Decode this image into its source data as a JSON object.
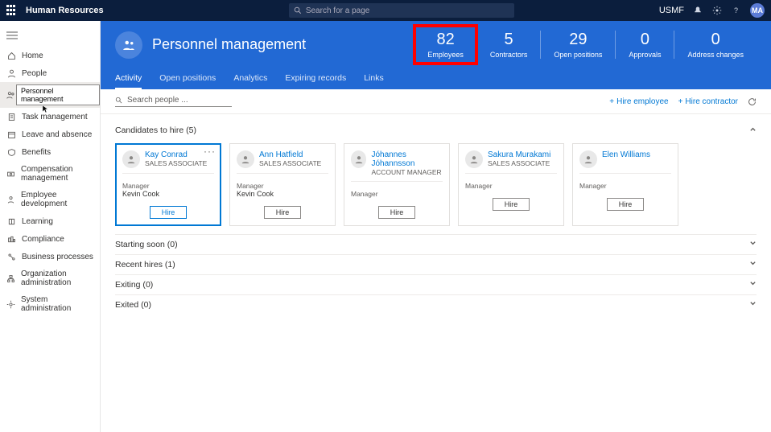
{
  "topbar": {
    "app_title": "Human Resources",
    "search_placeholder": "Search for a page",
    "company": "USMF",
    "avatar_initials": "MA"
  },
  "sidebar": {
    "tooltip": "Personnel management",
    "items": [
      {
        "id": "home",
        "label": "Home"
      },
      {
        "id": "people",
        "label": "People"
      },
      {
        "id": "personnel",
        "label": "Personnel management"
      },
      {
        "id": "task",
        "label": "Task management"
      },
      {
        "id": "leave",
        "label": "Leave and absence"
      },
      {
        "id": "benefits",
        "label": "Benefits"
      },
      {
        "id": "comp",
        "label": "Compensation management"
      },
      {
        "id": "empdev",
        "label": "Employee development"
      },
      {
        "id": "learning",
        "label": "Learning"
      },
      {
        "id": "compliance",
        "label": "Compliance"
      },
      {
        "id": "bizproc",
        "label": "Business processes"
      },
      {
        "id": "orgadmin",
        "label": "Organization administration"
      },
      {
        "id": "sysadmin",
        "label": "System administration"
      }
    ]
  },
  "hero": {
    "title": "Personnel management",
    "stats": [
      {
        "value": "82",
        "label": "Employees",
        "highlight": true
      },
      {
        "value": "5",
        "label": "Contractors"
      },
      {
        "value": "29",
        "label": "Open positions"
      },
      {
        "value": "0",
        "label": "Approvals"
      },
      {
        "value": "0",
        "label": "Address changes"
      }
    ],
    "tabs": [
      "Activity",
      "Open positions",
      "Analytics",
      "Expiring records",
      "Links"
    ],
    "active_tab": 0
  },
  "toolbar": {
    "search_placeholder": "Search people ...",
    "hire_employee": "Hire employee",
    "hire_contractor": "Hire contractor"
  },
  "sections": {
    "candidates": {
      "title": "Candidates to hire",
      "count": 5
    },
    "starting": {
      "title": "Starting soon",
      "count": 0
    },
    "recent": {
      "title": "Recent hires",
      "count": 1
    },
    "exiting": {
      "title": "Exiting",
      "count": 0
    },
    "exited": {
      "title": "Exited",
      "count": 0
    }
  },
  "card_labels": {
    "manager": "Manager",
    "hire": "Hire"
  },
  "candidates": [
    {
      "name": "Kay Conrad",
      "role": "SALES ASSOCIATE",
      "manager": "Kevin Cook",
      "selected": true
    },
    {
      "name": "Ann Hatfield",
      "role": "SALES ASSOCIATE",
      "manager": "Kevin Cook"
    },
    {
      "name": "Jóhannes Jóhannsson",
      "role": "ACCOUNT MANAGER",
      "manager": ""
    },
    {
      "name": "Sakura Murakami",
      "role": "SALES ASSOCIATE",
      "manager": ""
    },
    {
      "name": "Elen Williams",
      "role": "",
      "manager": ""
    }
  ]
}
